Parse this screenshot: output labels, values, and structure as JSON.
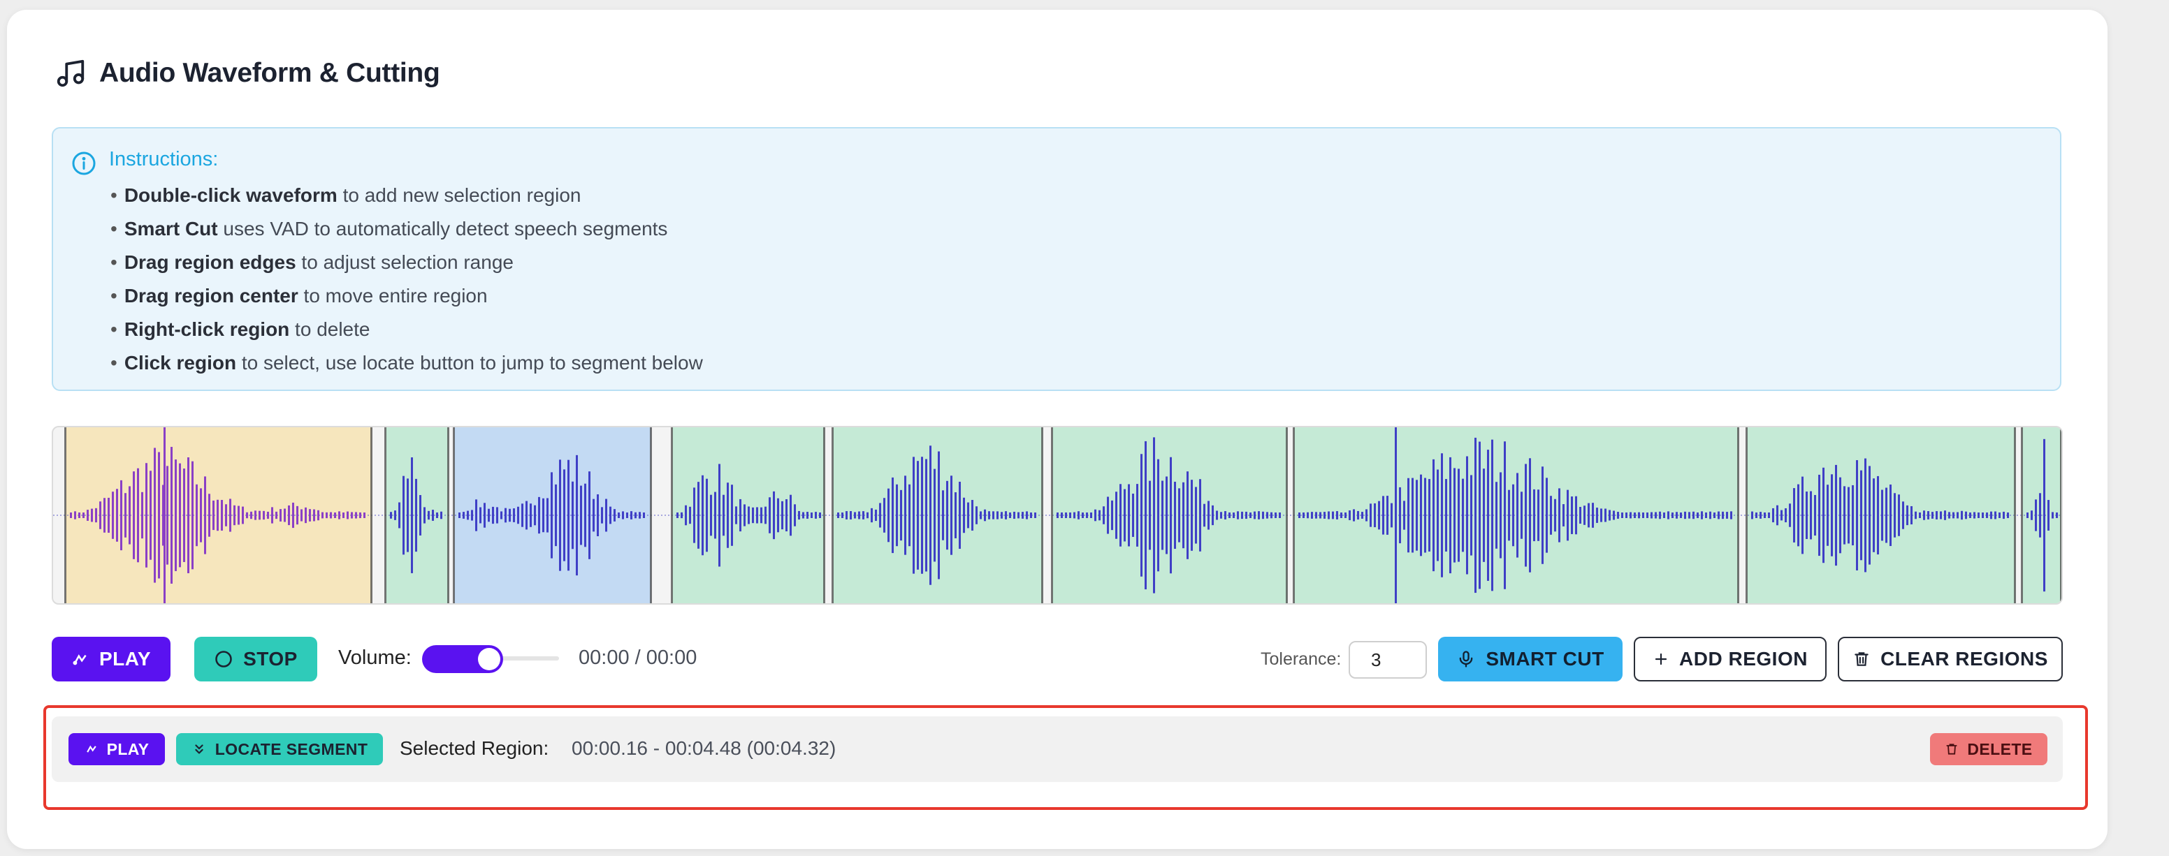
{
  "header": {
    "title": "Audio Waveform & Cutting",
    "icon": "music-note-icon"
  },
  "instructions": {
    "title": "Instructions:",
    "icon": "info-icon",
    "items": [
      {
        "bold": "Double-click waveform",
        "rest": " to add new selection region"
      },
      {
        "bold": "Smart Cut",
        "rest": " uses VAD to automatically detect speech segments"
      },
      {
        "bold": "Drag region edges",
        "rest": " to adjust selection range"
      },
      {
        "bold": "Drag region center",
        "rest": " to move entire region"
      },
      {
        "bold": "Right-click region",
        "rest": " to delete"
      },
      {
        "bold": "Click region",
        "rest": " to select, use locate button to jump to segment below"
      }
    ]
  },
  "waveform": {
    "region_count": 9,
    "colors": {
      "wave": "#3f3fc6",
      "wave_selected_region": "#8a3fc6",
      "region_green": "#c5ead6",
      "region_blue": "#c3daf3",
      "region_yellow": "#f6e6bd"
    }
  },
  "controls": {
    "play_label": "PLAY",
    "stop_label": "STOP",
    "volume_label": "Volume:",
    "volume_level": 0.6,
    "current_time": "00:00",
    "time_separator": " / ",
    "total_time": "00:00",
    "tolerance_label": "Tolerance:",
    "tolerance_value": "3",
    "smart_cut_label": "SMART CUT",
    "add_region_label": "ADD REGION",
    "clear_regions_label": "CLEAR REGIONS"
  },
  "selection": {
    "play_label": "PLAY",
    "locate_label": "LOCATE SEGMENT",
    "label": "Selected Region:",
    "range": "00:00.16 - 00:04.48 (00:04.32)",
    "delete_label": "DELETE"
  },
  "colors": {
    "primary": "#5a12f0",
    "teal": "#2fcbb9",
    "sky": "#36b2f0",
    "danger": "#f07a7a",
    "highlight": "#e8382d"
  }
}
